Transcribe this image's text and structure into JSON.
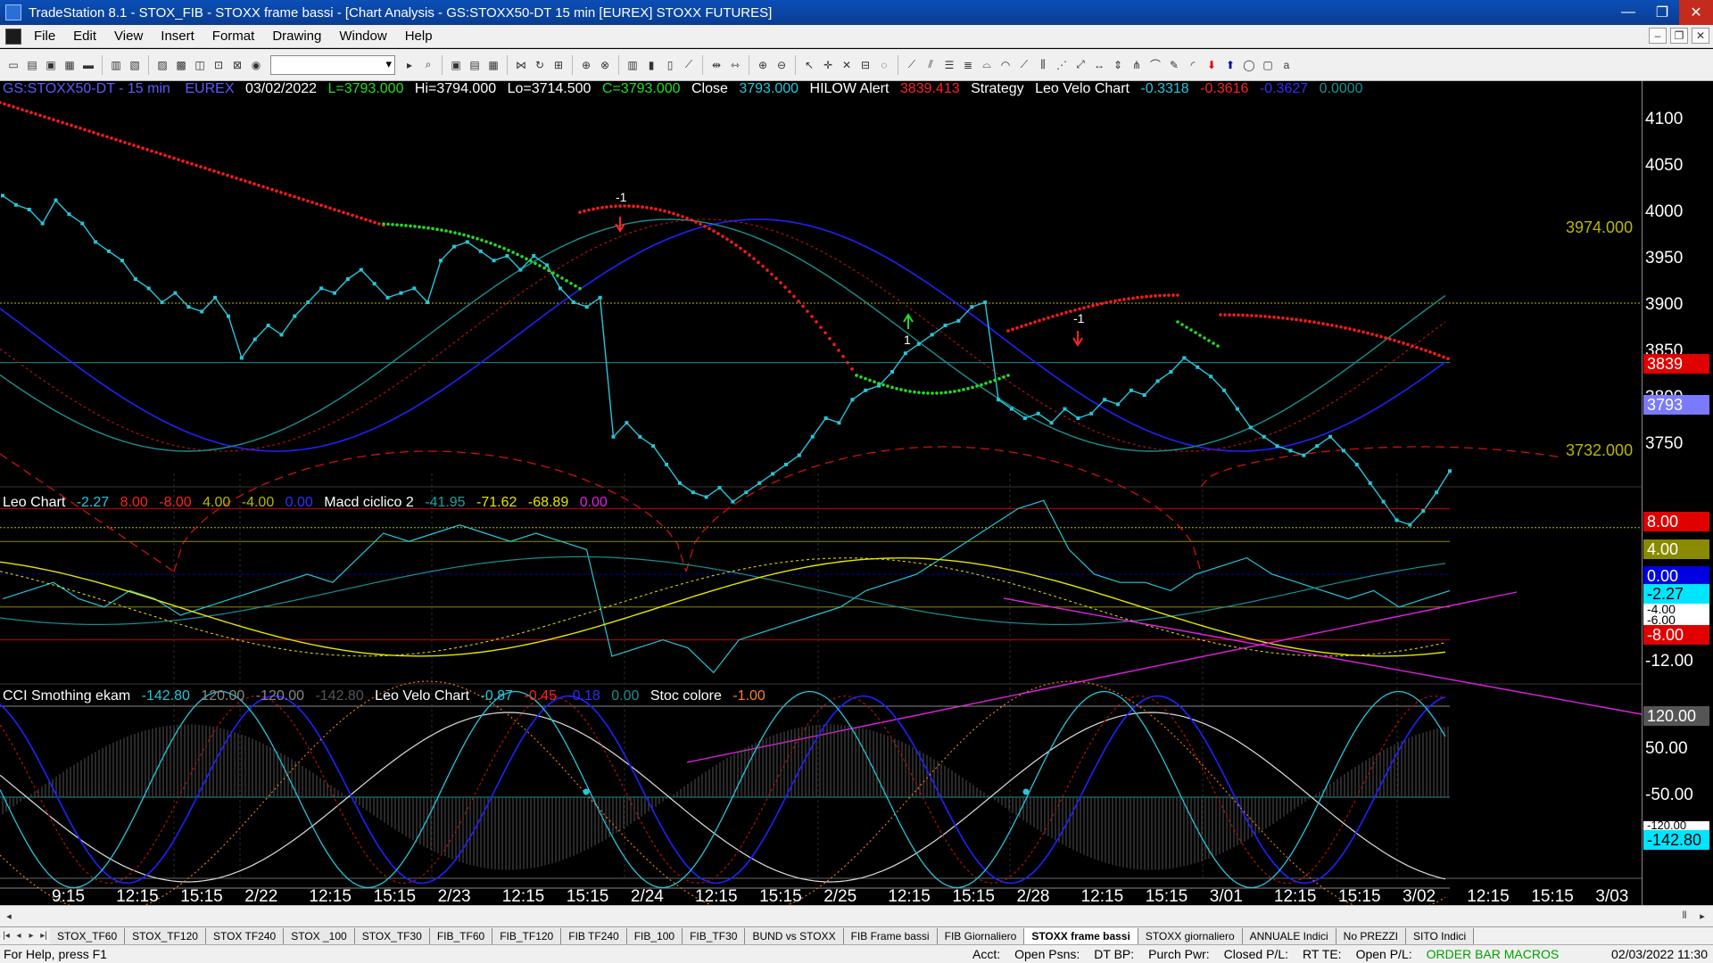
{
  "window": {
    "title": "TradeStation 8.1 - STOX_FIB - STOXX frame bassi - [Chart Analysis - GS:STOXX50-DT  15 min  [EUREX] STOXX FUTURES]",
    "minimize": "—",
    "restore": "❐",
    "close": "✕"
  },
  "menu": {
    "items": [
      "File",
      "Edit",
      "View",
      "Insert",
      "Format",
      "Drawing",
      "Window",
      "Help"
    ],
    "mdi": [
      "–",
      "❐",
      "✕"
    ]
  },
  "header": {
    "symbol": "GS:STOXX50-DT - 15 min",
    "exchange": "EUREX",
    "date": "03/02/2022",
    "last": "L=3793.000",
    "high": "Hi=3794.000",
    "low": "Lo=3714.500",
    "close_c": "C=3793.000",
    "close_lbl": "Close",
    "close_val": "3793.000",
    "hilow_lbl": "HILOW Alert",
    "hilow_val": "3839.413",
    "strategy_lbl": "Strategy",
    "velo_lbl": "Leo Velo Chart",
    "velo_v1": "-0.3318",
    "velo_v2": "-0.3616",
    "velo_v3": "-0.3627",
    "velo_v4": "0.0000"
  },
  "panel2": {
    "leo_lbl": "Leo Chart",
    "v1": "-2.27",
    "v2": "8.00",
    "v3": "-8.00",
    "v4": "4.00",
    "v5": "-4.00",
    "v6": "0.00",
    "macd_lbl": "Macd ciclico 2",
    "m1": "-41.95",
    "m2": "-71.62",
    "m3": "-68.89",
    "m4": "0.00"
  },
  "panel3": {
    "cci_lbl": "CCI Smothing ekam",
    "c1": "-142.80",
    "c2": "120.00",
    "c3": "-120.00",
    "c4": "-142.80",
    "velo_lbl": "Leo Velo Chart",
    "w1": "-0.87",
    "w2": "-0.45",
    "w3": "-0.18",
    "w4": "0.00",
    "stoc_lbl": "Stoc colore",
    "s1": "-1.00"
  },
  "price_axis": {
    "p1": {
      "labels": [
        "4100",
        "4050",
        "4000",
        "3950",
        "3900",
        "3850",
        "3800",
        "3750"
      ],
      "values": [
        4100,
        4050,
        4000,
        3950,
        3900,
        3850,
        3800,
        3750
      ]
    },
    "p2": {
      "labels": [
        "8.00",
        "4.00",
        "0.00",
        "-4.00",
        "-8.00",
        "-12.00"
      ],
      "values": [
        8,
        4,
        0,
        -4,
        -8,
        -12
      ]
    },
    "p3": {
      "labels": [
        "120.00",
        "50.00",
        "-50.00",
        "-120.00"
      ],
      "values": [
        120,
        50,
        -50,
        -120
      ]
    }
  },
  "tags": {
    "hilow": "3839",
    "last": "3793",
    "leo_8": "8.00",
    "leo_4": "4.00",
    "leo_0": "0.00",
    "leo_cur": "-2.27",
    "leo_m4": "-4.00",
    "leo_m6": "-6.00",
    "leo_m8": "-8.00",
    "cci_120": "120.00",
    "cci_m120": "-120.00",
    "cci_cur": "-142.80"
  },
  "levels": {
    "upper": "3974.000",
    "lower": "3732.000"
  },
  "signals": {
    "s1": "-1",
    "s2": "1",
    "s3": "-1"
  },
  "time_axis": [
    "9:15",
    "12:15",
    "15:15",
    "2/22",
    "12:15",
    "15:15",
    "2/23",
    "12:15",
    "15:15",
    "2/24",
    "12:15",
    "15:15",
    "2/25",
    "12:15",
    "15:15",
    "2/28",
    "12:15",
    "15:15",
    "3/01",
    "12:15",
    "15:15",
    "3/02",
    "12:15",
    "15:15",
    "3/03"
  ],
  "tabs": [
    "STOX_TF60",
    "STOX_TF120",
    "STOX TF240",
    "STOX _100",
    "STOX_TF30",
    "FIB_TF60",
    "FIB_TF120",
    "FIB TF240",
    "FIB_100",
    "FIB_TF30",
    "BUND vs STOXX",
    "FIB Frame bassi",
    "FIB Giornaliero",
    "STOXX frame bassi",
    "STOXX giornaliero",
    "ANNUALE Indici",
    "No PREZZI",
    "SITO Indici"
  ],
  "active_tab": "STOXX frame bassi",
  "status": {
    "help": "For Help, press F1",
    "acct": "Acct:",
    "open_psns": "Open Psns:",
    "dt_bp": "DT BP:",
    "purch_pwr": "Purch Pwr:",
    "closed_pl": "Closed P/L:",
    "rt_te": "RT TE:",
    "open_pl": "Open P/L:",
    "macros": "ORDER BAR  MACROS",
    "datetime": "02/03/2022 11:30"
  },
  "colors": {
    "price": "#26c6da",
    "red_dots": "#ff1a1a",
    "green_dots": "#22dd22",
    "blue_line": "#2020ff",
    "teal_line": "#1a8f8f",
    "yellow": "#e6e600",
    "magenta": "#e020e0",
    "level": "#b8b800"
  }
}
